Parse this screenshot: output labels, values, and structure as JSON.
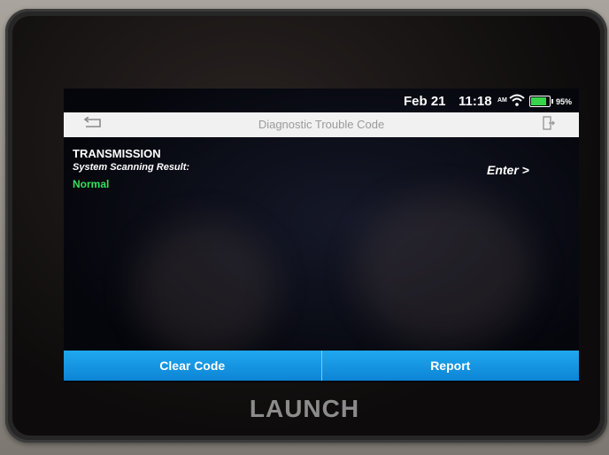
{
  "status": {
    "date": "Feb 21",
    "time": "11:18",
    "ampm": "AM",
    "battery_percent": "95%",
    "battery_level": 0.95,
    "wifi_icon": "wifi-icon"
  },
  "titlebar": {
    "title": "Diagnostic Trouble Code",
    "back_icon": "back-arrow-icon",
    "exit_icon": "exit-icon"
  },
  "result": {
    "system": "TRANSMISSION",
    "label": "System Scanning Result:",
    "value": "Normal",
    "enter": "Enter >"
  },
  "actions": {
    "clear_code": "Clear Code",
    "report": "Report"
  },
  "device": {
    "brand": "LAUNCH"
  },
  "colors": {
    "accent": "#1fa8ee",
    "normal_status": "#34e25a",
    "battery": "#36d44b"
  }
}
